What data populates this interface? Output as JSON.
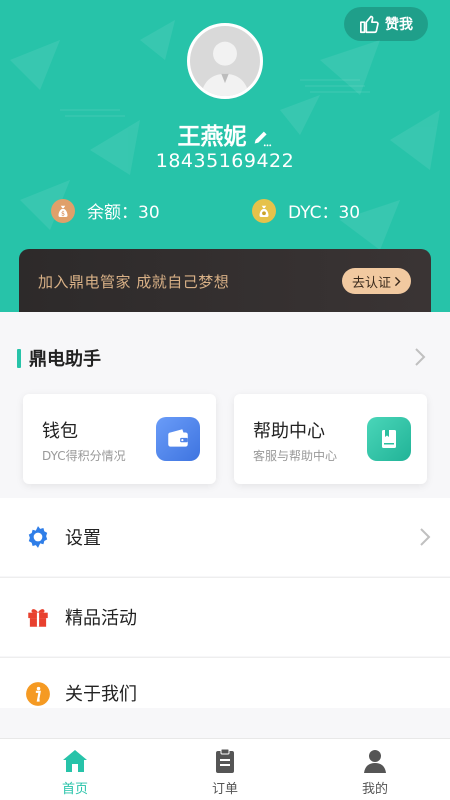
{
  "header": {
    "like_label": "赞我",
    "user_name": "王燕妮",
    "phone": "18435169422",
    "balance_label": "余额：30",
    "dyc_label": "DYC：30",
    "accent_color": "#27c3a9"
  },
  "banner": {
    "text": "加入鼎电管家 成就自己梦想",
    "button_label": "去认证"
  },
  "assistant": {
    "title": "鼎电助手",
    "cards": [
      {
        "title": "钱包",
        "subtitle": "DYC得积分情况",
        "icon": "wallet-icon"
      },
      {
        "title": "帮助中心",
        "subtitle": "客服与帮助中心",
        "icon": "book-icon"
      }
    ]
  },
  "menu": [
    {
      "label": "设置",
      "icon": "gear-icon"
    },
    {
      "label": "精品活动",
      "icon": "gift-icon"
    },
    {
      "label": "关于我们",
      "icon": "info-icon"
    }
  ],
  "tabbar": {
    "tabs": [
      {
        "label": "首页",
        "icon": "home-icon",
        "active": true
      },
      {
        "label": "订单",
        "icon": "clipboard-icon",
        "active": false
      },
      {
        "label": "我的",
        "icon": "person-icon",
        "active": false
      }
    ]
  }
}
